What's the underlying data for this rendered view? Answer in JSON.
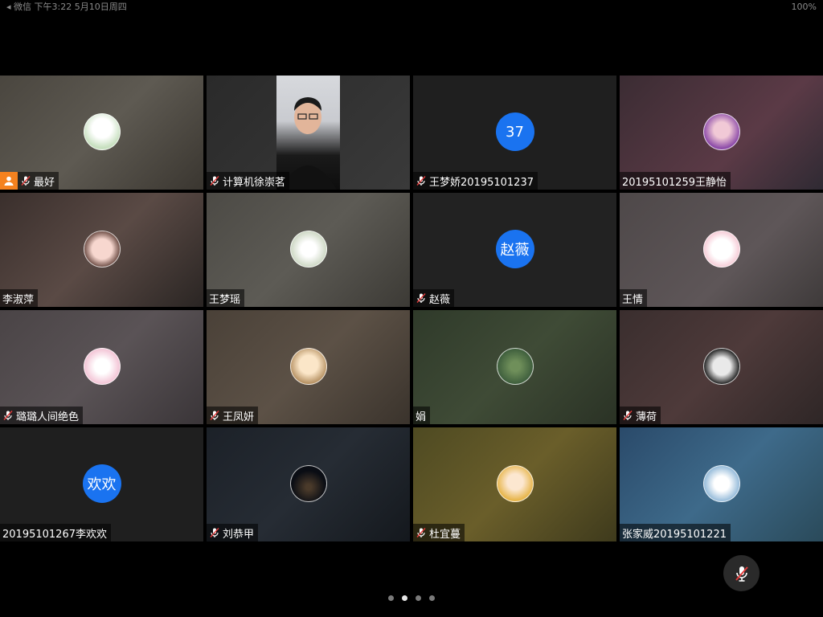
{
  "status_bar": {
    "left": "◂ 微信  下午3:22  5月10日周四",
    "right": "100%"
  },
  "participants": [
    {
      "name": "最好",
      "muted": true,
      "host": true,
      "avatar_type": "image",
      "avatar_icon": "cow-hat-cartoon"
    },
    {
      "name": "计算机徐崇茗",
      "muted": true,
      "host": false,
      "avatar_type": "video",
      "avatar_icon": "camera-feed"
    },
    {
      "name": "王梦娇20195101237",
      "muted": true,
      "host": false,
      "avatar_type": "text",
      "avatar_text": "37"
    },
    {
      "name": "20195101259王静怡",
      "muted": false,
      "host": false,
      "avatar_type": "image",
      "avatar_icon": "anime-girl"
    },
    {
      "name": "李淑萍",
      "muted": false,
      "host": false,
      "avatar_type": "image",
      "avatar_icon": "baby-photo"
    },
    {
      "name": "王梦瑶",
      "muted": false,
      "host": false,
      "avatar_type": "image",
      "avatar_icon": "flower-photo"
    },
    {
      "name": "赵薇",
      "muted": true,
      "host": false,
      "avatar_type": "text",
      "avatar_text": "赵薇"
    },
    {
      "name": "王情",
      "muted": false,
      "host": false,
      "avatar_type": "image",
      "avatar_icon": "pink-bunny"
    },
    {
      "name": "璐璐人间绝色",
      "muted": true,
      "host": false,
      "avatar_type": "image",
      "avatar_icon": "anime-pink-hair"
    },
    {
      "name": "王凤妍",
      "muted": true,
      "host": false,
      "avatar_type": "image",
      "avatar_icon": "cartoon-boy"
    },
    {
      "name": "娟",
      "muted": false,
      "host": false,
      "avatar_type": "image",
      "avatar_icon": "plant-photo"
    },
    {
      "name": "薄荷",
      "muted": true,
      "host": false,
      "avatar_type": "image",
      "avatar_icon": "panda-meme"
    },
    {
      "name": "20195101267李欢欢",
      "muted": false,
      "host": false,
      "avatar_type": "text",
      "avatar_text": "欢欢"
    },
    {
      "name": "刘恭甲",
      "muted": true,
      "host": false,
      "avatar_type": "image",
      "avatar_icon": "night-sky"
    },
    {
      "name": "杜宜蔓",
      "muted": true,
      "host": false,
      "avatar_type": "image",
      "avatar_icon": "leopard-girl"
    },
    {
      "name": "张家威20195101221",
      "muted": false,
      "host": false,
      "avatar_type": "image",
      "avatar_icon": "skier-photo"
    }
  ],
  "colors": {
    "avatar_blue": "#1a73f0",
    "host_orange": "#f5821f"
  },
  "pagination": {
    "total": 4,
    "active": 1
  },
  "controls": {
    "mute_icon": "mic-off-icon"
  }
}
